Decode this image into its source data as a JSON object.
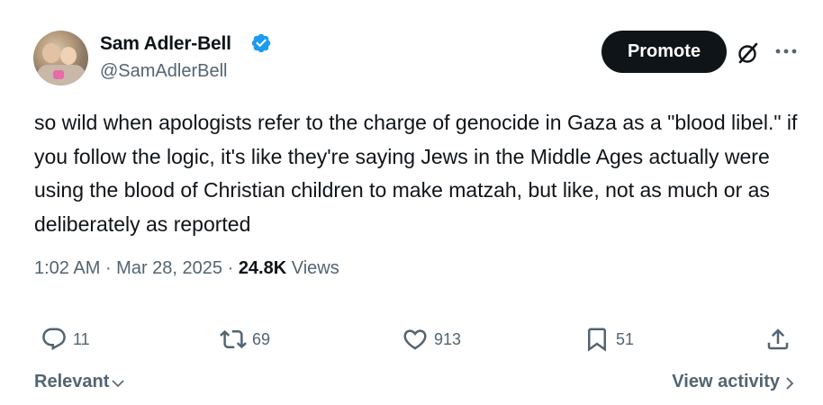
{
  "author": {
    "display_name": "Sam Adler-Bell",
    "handle": "@SamAdlerBell",
    "verified": true,
    "verified_color": "#1d9bf0"
  },
  "header": {
    "promote_label": "Promote",
    "grok_icon": "grok-icon",
    "more_icon": "more-horizontal-icon"
  },
  "tweet": {
    "text": "so wild when apologists refer to the charge of genocide in Gaza as a \"blood libel.\" if you follow the logic, it's like they're saying Jews in the Middle Ages actually were using the blood of Christian children to make matzah, but like, not as much or as deliberately as reported",
    "time": "1:02 AM",
    "date": "Mar 28, 2025",
    "views_count": "24.8K",
    "views_label": "Views"
  },
  "actions": {
    "replies": "11",
    "retweets": "69",
    "likes": "913",
    "bookmarks": "51"
  },
  "footer": {
    "sort_label": "Relevant",
    "activity_label": "View activity"
  }
}
